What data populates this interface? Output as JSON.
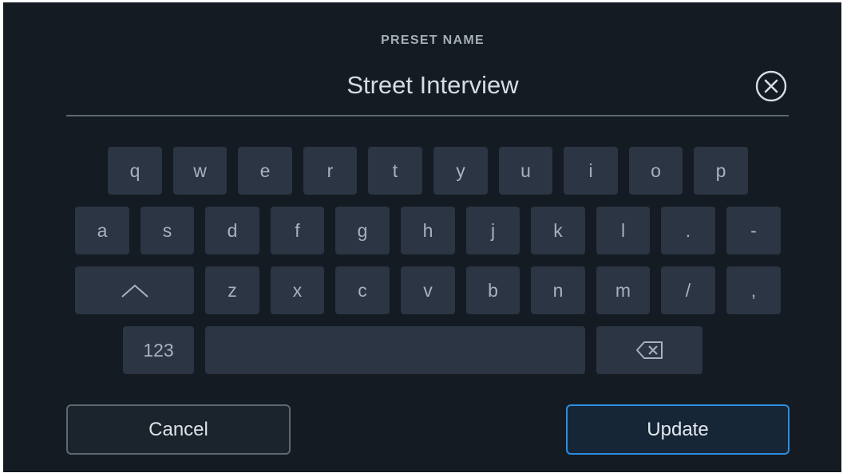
{
  "header": {
    "title": "PRESET NAME",
    "value": "Street Interview"
  },
  "keyboard": {
    "row1": [
      "q",
      "w",
      "e",
      "r",
      "t",
      "y",
      "u",
      "i",
      "o",
      "p"
    ],
    "row2": [
      "a",
      "s",
      "d",
      "f",
      "g",
      "h",
      "j",
      "k",
      "l",
      ".",
      "-"
    ],
    "row3": [
      "z",
      "x",
      "c",
      "v",
      "b",
      "n",
      "m",
      "/",
      ","
    ],
    "numbers_label": "123",
    "shift_icon": "caret-up-icon",
    "backspace_icon": "backspace-icon"
  },
  "actions": {
    "cancel_label": "Cancel",
    "update_label": "Update"
  },
  "colors": {
    "background": "#141b22",
    "key": "#2b3543",
    "accent": "#2c8ee0"
  }
}
